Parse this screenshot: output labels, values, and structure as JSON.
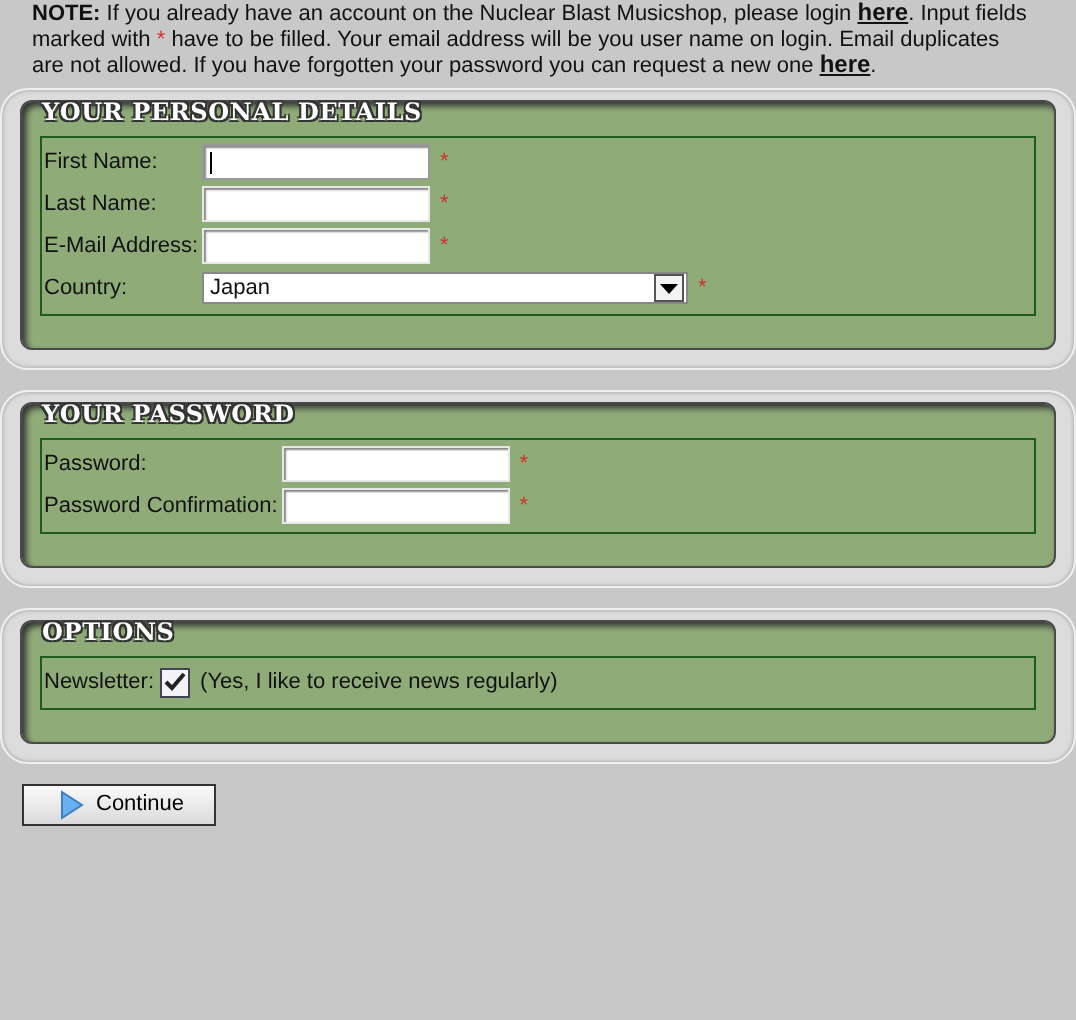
{
  "note": [
    {
      "kind": "text",
      "text": "**NOTE:** If you already have an account on the Nuclear Blast Musicshop, please login "
    },
    {
      "kind": "link",
      "text": "here"
    },
    {
      "kind": "text",
      "text": ". Input fields marked with "
    },
    {
      "kind": "mark",
      "text": "*"
    },
    {
      "kind": "text",
      "text": " have to be filled. Your email address will be you user name on login. Email duplicates are not allowed. If you have forgotten your password you can request a new one "
    },
    {
      "kind": "link",
      "text": "here"
    },
    {
      "kind": "text",
      "text": "."
    }
  ],
  "sections": [
    {
      "title": "YOUR PERSONAL DETAILS",
      "fields": [
        {
          "kind": "text",
          "label": "First Name:",
          "required_mark": "*",
          "focused": true
        },
        {
          "kind": "text",
          "label": "Last Name:",
          "required_mark": "*",
          "focused": false
        },
        {
          "kind": "text",
          "label": "E-Mail Address:",
          "required_mark": "*",
          "focused": false
        },
        {
          "kind": "select",
          "label": "Country:",
          "value": "Japan",
          "required_mark": "*"
        }
      ]
    },
    {
      "title": "YOUR PASSWORD",
      "fields": [
        {
          "kind": "password",
          "label": "Password:",
          "required_mark": "*",
          "focused": false
        },
        {
          "kind": "password",
          "label": "Password Confirmation:",
          "required_mark": "*",
          "focused": false
        }
      ]
    },
    {
      "title": "OPTIONS",
      "fields": [
        {
          "kind": "checkbox",
          "label": "Newsletter:",
          "checked": true,
          "caption": "(Yes, I like to receive news regularly)"
        }
      ]
    }
  ],
  "button": {
    "label": "Continue"
  }
}
